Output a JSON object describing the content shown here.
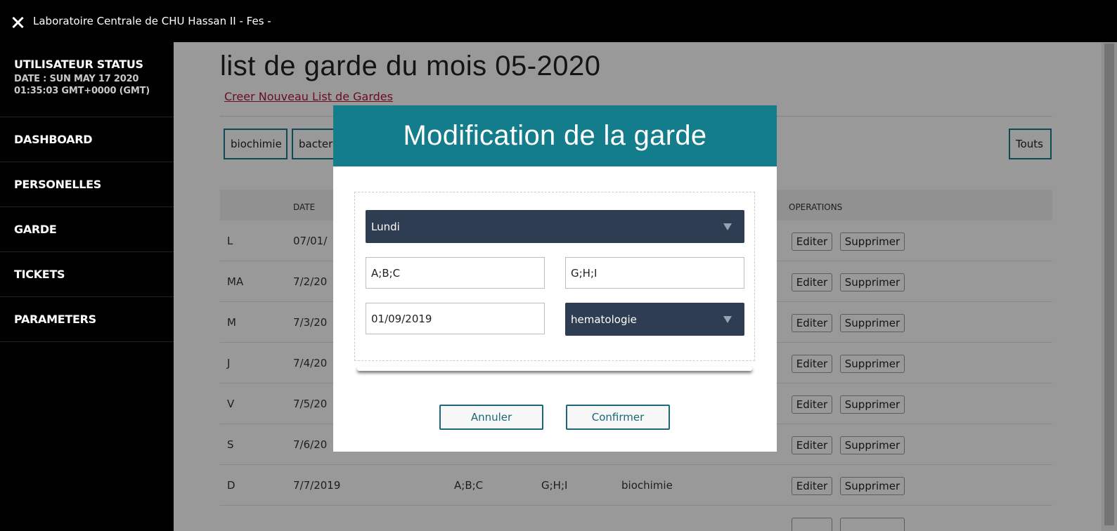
{
  "app": {
    "title": "Laboratoire Centrale de CHU Hassan II - Fes -"
  },
  "sidebar": {
    "status_title": "UTILISATEUR STATUS",
    "status_date": "DATE : SUN MAY 17 2020",
    "status_time": "01:35:03 GMT+0000 (GMT)",
    "items": [
      {
        "label": "DASHBOARD"
      },
      {
        "label": "PERSONELLES"
      },
      {
        "label": "GARDE"
      },
      {
        "label": "TICKETS"
      },
      {
        "label": "PARAMETERS"
      }
    ]
  },
  "main": {
    "title": "list de garde du mois 05-2020",
    "create_link": "Creer Nouveau List de Gardes",
    "filters": [
      "biochimie",
      "bacter"
    ],
    "filter_all": "Touts",
    "columns": {
      "date": "DATE",
      "operations": "OPERATIONS"
    },
    "rows": [
      {
        "day": "L",
        "date": "07/01/"
      },
      {
        "day": "MA",
        "date": "7/2/20"
      },
      {
        "day": "M",
        "date": "7/3/20"
      },
      {
        "day": "J",
        "date": "7/4/20"
      },
      {
        "day": "V",
        "date": "7/5/20"
      },
      {
        "day": "S",
        "date": "7/6/20"
      },
      {
        "day": "D",
        "date": "7/7/2019",
        "team1": "A;B;C",
        "team2": "G;H;I",
        "service": "biochimie"
      }
    ],
    "edit_label": "Editer",
    "delete_label": "Supprimer"
  },
  "modal": {
    "title": "Modification de la garde",
    "day_select": "Lundi",
    "team1": "A;B;C",
    "team2": "G;H;I",
    "date": "01/09/2019",
    "service_select": "hematologie",
    "cancel_label": "Annuler",
    "confirm_label": "Confirmer"
  }
}
